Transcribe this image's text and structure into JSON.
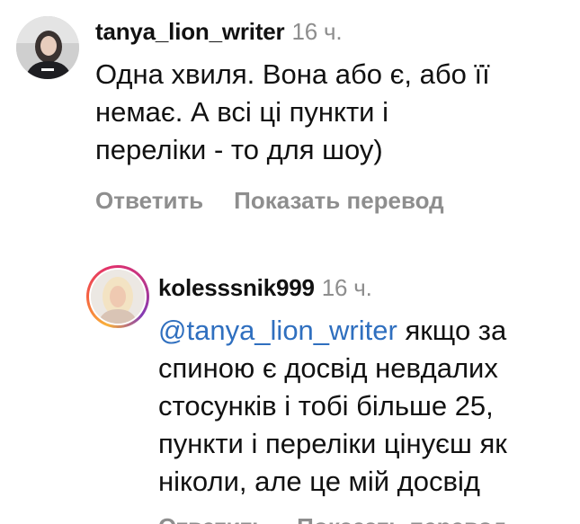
{
  "comments": [
    {
      "username": "tanya_lion_writer",
      "time": "16 ч.",
      "lines": [
        "Одна хвиля. Вона або є, або її",
        "немає. А всі ці пункти і",
        "переліки - то для шоу)"
      ],
      "actions": {
        "reply": "Ответить",
        "translate": "Показать перевод"
      }
    },
    {
      "username": "kolesssnik999",
      "time": "16 ч.",
      "mention": "@tanya_lion_writer",
      "first_line_rest": " якщо за",
      "lines": [
        "спиною є досвід невдалих",
        "стосунків і тобі більше 25,",
        "пункти і переліки цінуєш як",
        "ніколи, але це мій досвід"
      ],
      "actions": {
        "reply": "Ответить",
        "translate": "Показать перевод"
      }
    }
  ],
  "colors": {
    "mention": "#2f6fbf",
    "muted": "#8e8e8e",
    "story_ring": [
      "#f9b13a",
      "#e1306c",
      "#833ab4"
    ]
  }
}
